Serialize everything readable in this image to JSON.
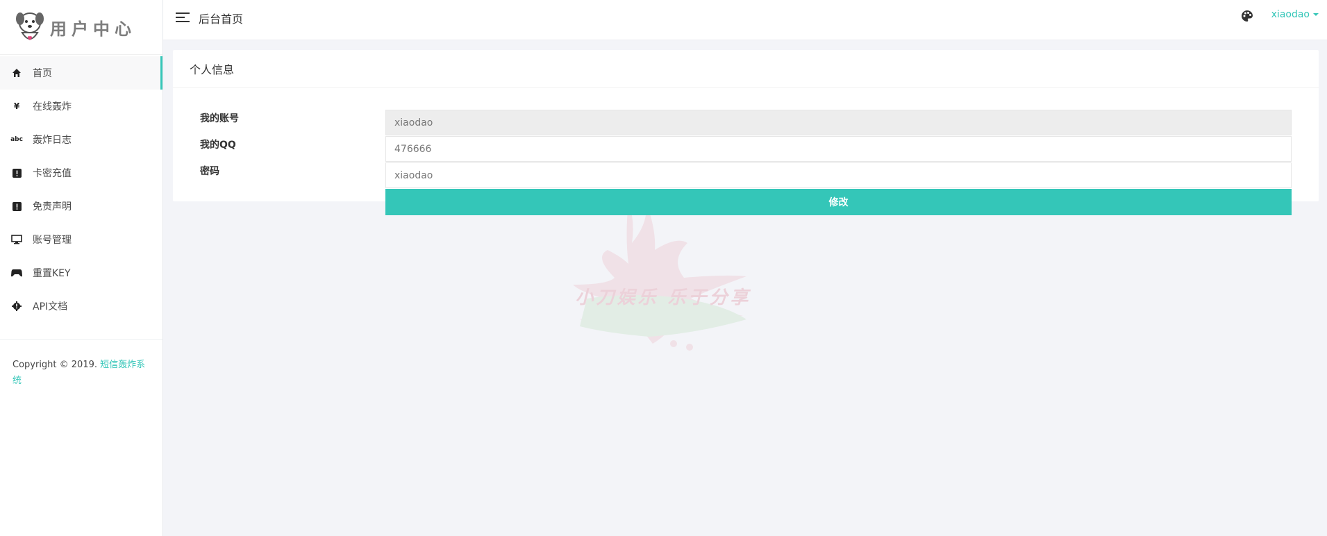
{
  "logo": {
    "text": "用户中心"
  },
  "sidebar": {
    "items": [
      {
        "label": "首页",
        "icon": "home-icon",
        "active": true
      },
      {
        "label": "在线轰炸",
        "icon": "yen-icon"
      },
      {
        "label": "轰炸日志",
        "icon": "abc-icon"
      },
      {
        "label": "卡密充值",
        "icon": "alert-icon"
      },
      {
        "label": "免责声明",
        "icon": "alert-icon"
      },
      {
        "label": "账号管理",
        "icon": "monitor-icon"
      },
      {
        "label": "重置KEY",
        "icon": "gamepad-icon"
      },
      {
        "label": "API文档",
        "icon": "gear-icon"
      }
    ],
    "copyright_prefix": "Copyright © 2019.",
    "copyright_link": "短信轰炸系统"
  },
  "header": {
    "title": "后台首页",
    "username": "xiaodao"
  },
  "card": {
    "title": "个人信息",
    "fields": [
      {
        "label": "我的账号",
        "value": "xiaodao",
        "readonly": true
      },
      {
        "label": "我的QQ",
        "value": "476666"
      },
      {
        "label": "密码",
        "value": "xiaodao"
      }
    ],
    "submit_label": "修改"
  },
  "watermark": {
    "text": "小刀娱乐 乐于分享"
  },
  "colors": {
    "accent": "#34c6b8",
    "background": "#f3f4f8"
  }
}
